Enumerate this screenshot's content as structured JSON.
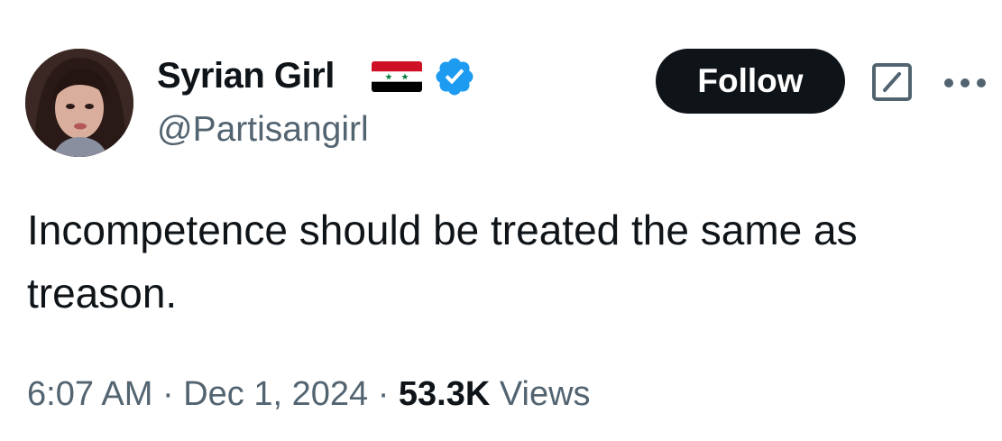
{
  "author": {
    "display_name": "Syrian Girl",
    "handle": "@Partisangirl",
    "flag": "syria-flag",
    "verified_color": "#1d9bf0"
  },
  "actions": {
    "follow_label": "Follow",
    "grok_icon": "grok-icon",
    "more_icon": "more-icon"
  },
  "tweet": {
    "text": "Incompetence should be treated the same as treason."
  },
  "meta": {
    "time": "6:07 AM",
    "separator": "·",
    "date": "Dec 1, 2024",
    "views_count": "53.3K",
    "views_label": "Views"
  },
  "colors": {
    "text_primary": "#0f1419",
    "text_secondary": "#536471",
    "button_bg": "#0f1419",
    "flag_red": "#ce1126",
    "flag_green": "#007a3d"
  }
}
